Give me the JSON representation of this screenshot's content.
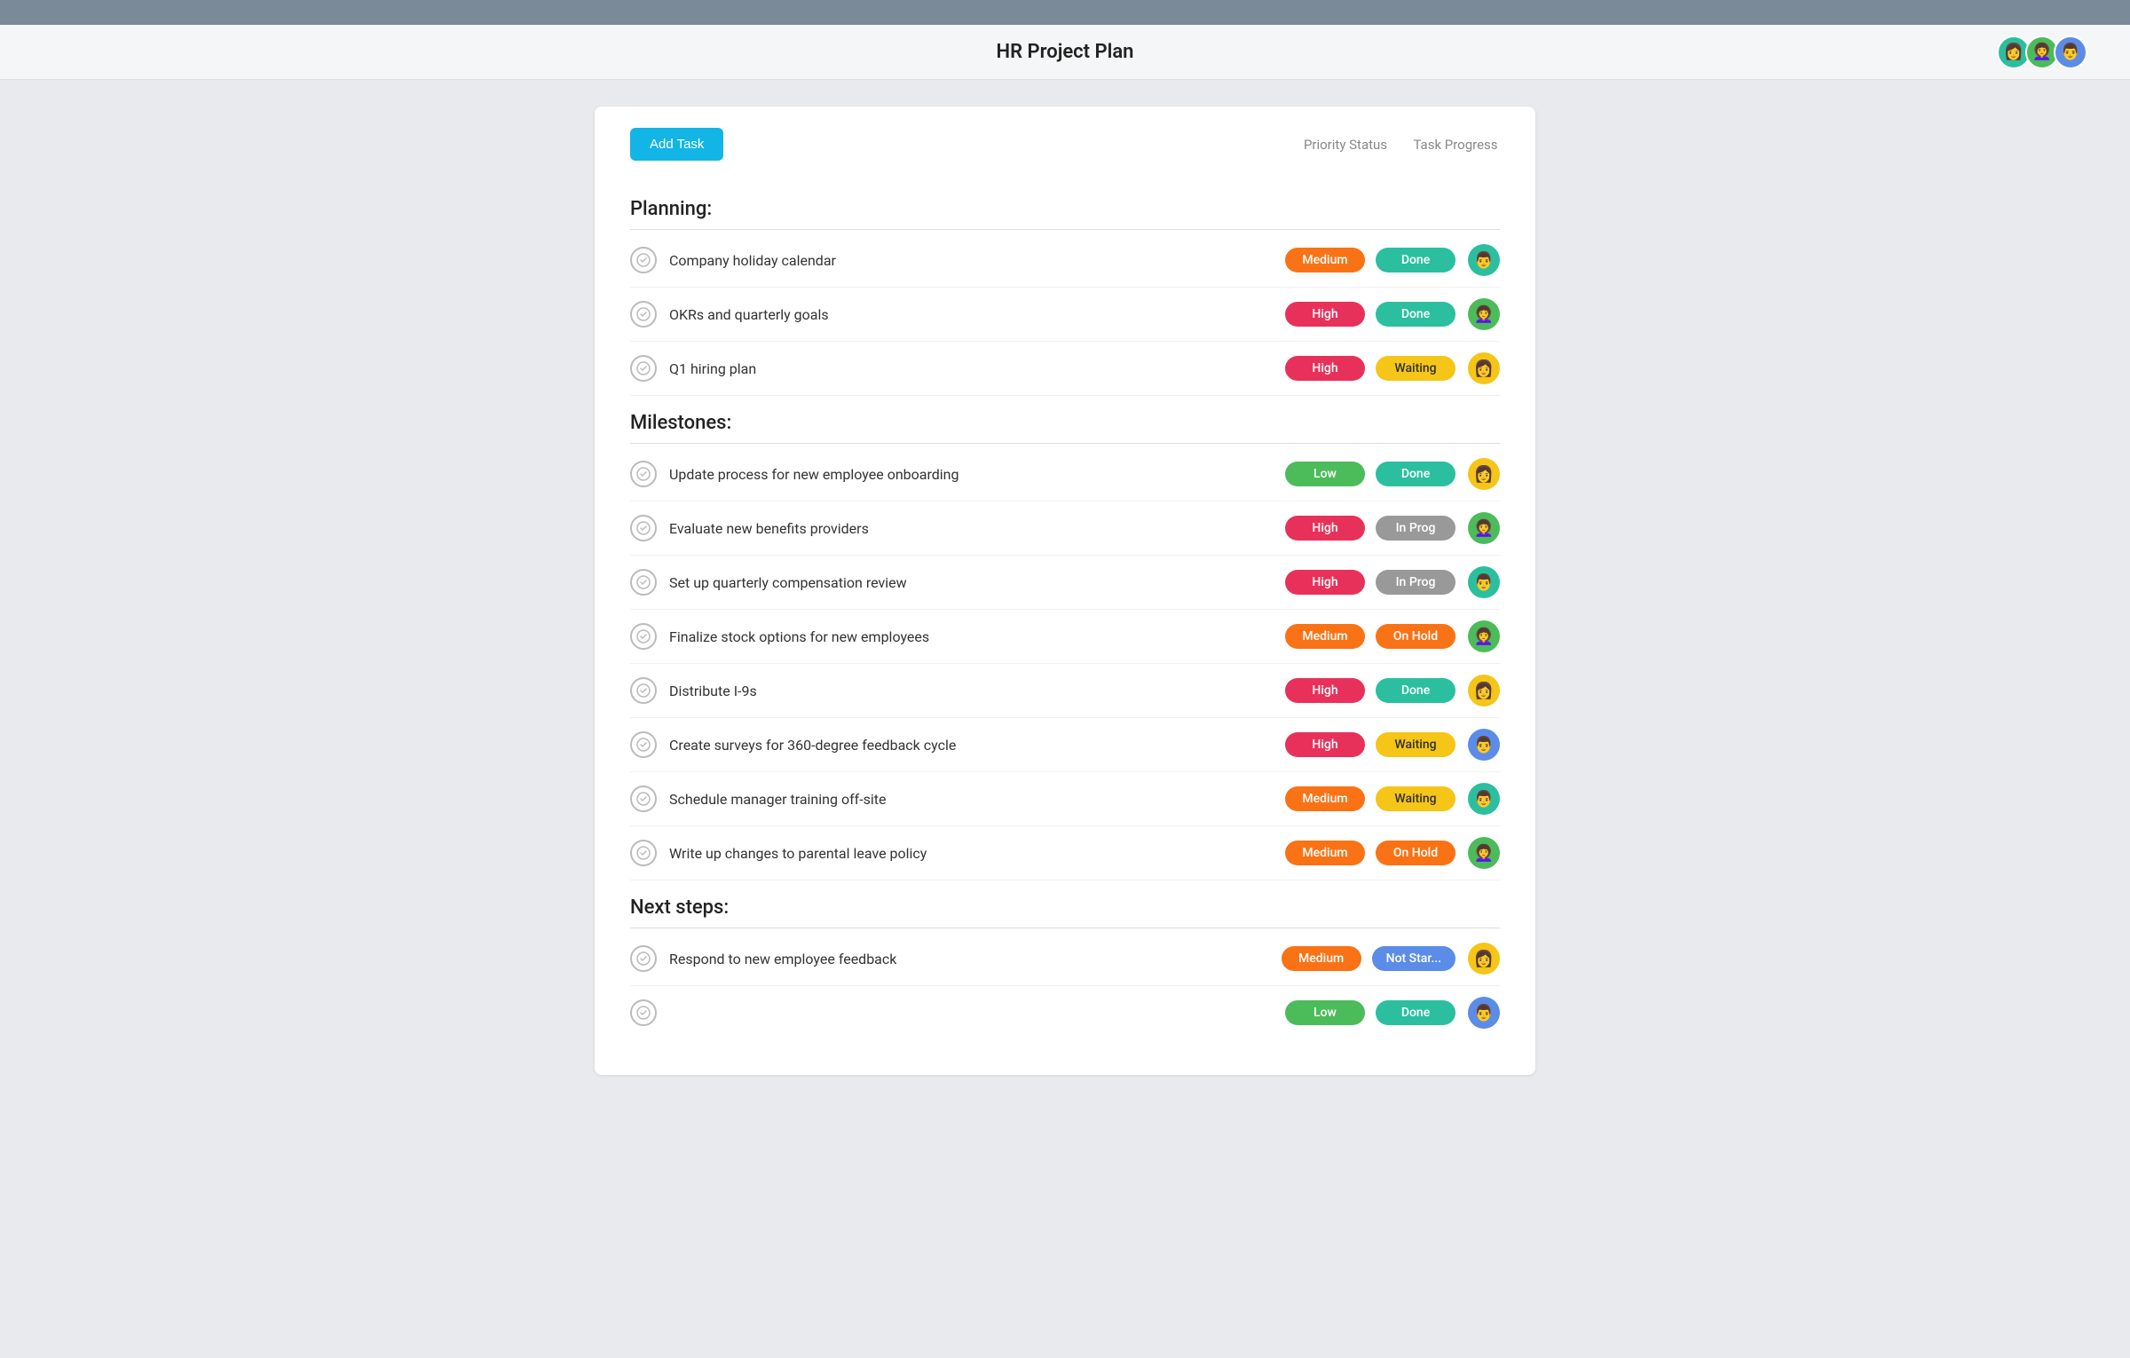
{
  "topbar": {},
  "header": {
    "title": "HR Project Plan",
    "avatars": [
      {
        "id": "av1",
        "color": "av-teal",
        "emoji": "👩"
      },
      {
        "id": "av2",
        "color": "av-green",
        "emoji": "👩‍🦱"
      },
      {
        "id": "av3",
        "color": "av-blue",
        "emoji": "👨"
      }
    ]
  },
  "toolbar": {
    "add_task_label": "Add Task",
    "col1": "Priority Status",
    "col2": "Task Progress"
  },
  "sections": [
    {
      "id": "planning",
      "title": "Planning:",
      "tasks": [
        {
          "id": "t1",
          "name": "Company holiday calendar",
          "priority": "Medium",
          "priority_class": "badge-medium",
          "status": "Done",
          "status_class": "status-done",
          "avatar_emoji": "👨",
          "avatar_color": "av-teal"
        },
        {
          "id": "t2",
          "name": "OKRs and quarterly goals",
          "priority": "High",
          "priority_class": "badge-high",
          "status": "Done",
          "status_class": "status-done",
          "avatar_emoji": "👩‍🦱",
          "avatar_color": "av-green"
        },
        {
          "id": "t3",
          "name": "Q1 hiring plan",
          "priority": "High",
          "priority_class": "badge-high",
          "status": "Waiting",
          "status_class": "status-waiting",
          "avatar_emoji": "👩",
          "avatar_color": "av-yellow"
        }
      ]
    },
    {
      "id": "milestones",
      "title": "Milestones:",
      "tasks": [
        {
          "id": "t4",
          "name": "Update process for new employee onboarding",
          "priority": "Low",
          "priority_class": "badge-low",
          "status": "Done",
          "status_class": "status-done",
          "avatar_emoji": "👩",
          "avatar_color": "av-yellow"
        },
        {
          "id": "t5",
          "name": "Evaluate new benefits providers",
          "priority": "High",
          "priority_class": "badge-high",
          "status": "In Prog",
          "status_class": "status-inprog",
          "avatar_emoji": "👩‍🦱",
          "avatar_color": "av-green"
        },
        {
          "id": "t6",
          "name": "Set up quarterly compensation review",
          "priority": "High",
          "priority_class": "badge-high",
          "status": "In Prog",
          "status_class": "status-inprog",
          "avatar_emoji": "👨",
          "avatar_color": "av-teal"
        },
        {
          "id": "t7",
          "name": "Finalize stock options for new employees",
          "priority": "Medium",
          "priority_class": "badge-medium",
          "status": "On Hold",
          "status_class": "status-onhold",
          "avatar_emoji": "👩‍🦱",
          "avatar_color": "av-green"
        },
        {
          "id": "t8",
          "name": "Distribute I-9s",
          "priority": "High",
          "priority_class": "badge-high",
          "status": "Done",
          "status_class": "status-done",
          "avatar_emoji": "👩",
          "avatar_color": "av-yellow"
        },
        {
          "id": "t9",
          "name": "Create surveys for 360-degree feedback cycle",
          "priority": "High",
          "priority_class": "badge-high",
          "status": "Waiting",
          "status_class": "status-waiting",
          "avatar_emoji": "👨",
          "avatar_color": "av-blue"
        },
        {
          "id": "t10",
          "name": "Schedule manager training off-site",
          "priority": "Medium",
          "priority_class": "badge-medium",
          "status": "Waiting",
          "status_class": "status-waiting",
          "avatar_emoji": "👨",
          "avatar_color": "av-teal"
        },
        {
          "id": "t11",
          "name": "Write up changes to parental leave policy",
          "priority": "Medium",
          "priority_class": "badge-medium",
          "status": "On Hold",
          "status_class": "status-onhold",
          "avatar_emoji": "👩‍🦱",
          "avatar_color": "av-green"
        }
      ]
    },
    {
      "id": "nextsteps",
      "title": "Next steps:",
      "tasks": [
        {
          "id": "t12",
          "name": "Respond to new employee feedback",
          "priority": "Medium",
          "priority_class": "badge-medium",
          "status": "Not Star...",
          "status_class": "status-notstar",
          "avatar_emoji": "👩",
          "avatar_color": "av-yellow"
        },
        {
          "id": "t13",
          "name": "...",
          "priority": "Low",
          "priority_class": "badge-low",
          "status": "...",
          "status_class": "status-done",
          "avatar_emoji": "👨",
          "avatar_color": "av-blue"
        }
      ]
    }
  ]
}
